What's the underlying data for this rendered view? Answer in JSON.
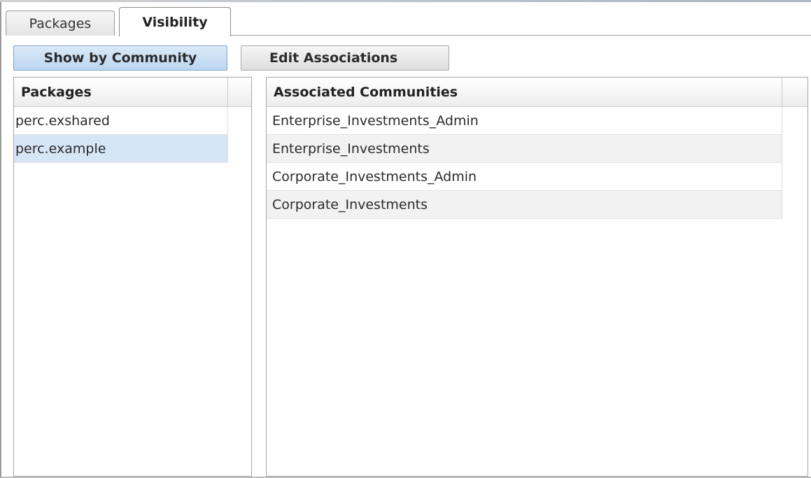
{
  "tabs": [
    {
      "label": "Packages",
      "active": false
    },
    {
      "label": "Visibility",
      "active": true
    }
  ],
  "toolbar": {
    "show_by_community_label": "Show by Community",
    "edit_associations_label": "Edit Associations"
  },
  "packages_panel": {
    "header": "Packages",
    "items": [
      {
        "label": "perc.exshared",
        "selected": false
      },
      {
        "label": "perc.example",
        "selected": true
      }
    ]
  },
  "communities_panel": {
    "header": "Associated Communities",
    "items": [
      {
        "label": "Enterprise_Investments_Admin"
      },
      {
        "label": "Enterprise_Investments"
      },
      {
        "label": "Corporate_Investments_Admin"
      },
      {
        "label": "Corporate_Investments"
      }
    ]
  },
  "colors": {
    "selected_row": "#d7e6f7",
    "active_button": "#bcd6f0"
  }
}
